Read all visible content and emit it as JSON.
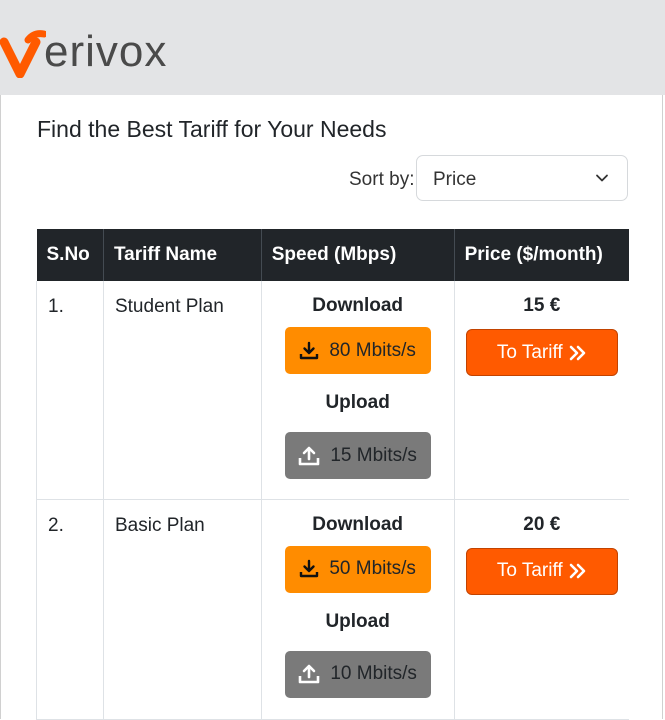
{
  "brand": {
    "name": "verivox",
    "logo_text": "erivox",
    "accent": "#ff5a00"
  },
  "page": {
    "title": "Find the Best Tariff for Your Needs"
  },
  "sort": {
    "label": "Sort by:",
    "selected": "Price"
  },
  "table": {
    "headers": [
      "S.No",
      "Tariff Name",
      "Speed (Mbps)",
      "Price ($/month)"
    ],
    "rows": [
      {
        "sno": "1.",
        "name": "Student Plan",
        "download_label": "Download",
        "download": "80 Mbits/s",
        "upload_label": "Upload",
        "upload": "15 Mbits/s",
        "price": "15 €",
        "button": "To Tariff"
      },
      {
        "sno": "2.",
        "name": "Basic Plan",
        "download_label": "Download",
        "download": "50 Mbits/s",
        "upload_label": "Upload",
        "upload": "10 Mbits/s",
        "price": "20 €",
        "button": "To Tariff"
      }
    ]
  },
  "colors": {
    "download_badge": "#ff8c00",
    "upload_badge": "#7a7a7a",
    "header_bg": "#212529"
  },
  "icons": {
    "download": "download-icon",
    "upload": "upload-icon",
    "button": "double-chevron-right-icon",
    "select": "chevron-down-icon"
  }
}
